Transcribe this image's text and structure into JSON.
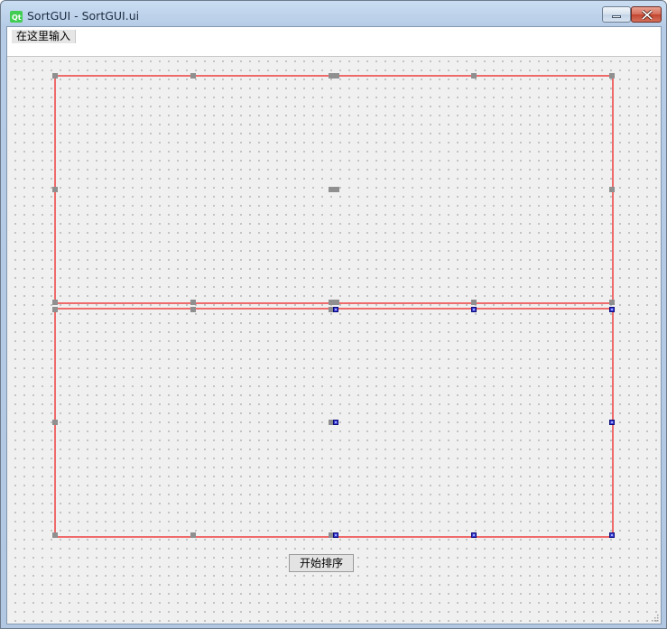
{
  "window": {
    "title": "SortGUI - SortGUI.ui",
    "icons": {
      "app": "qt-designer-icon",
      "minimize": "minimize-icon",
      "close": "close-icon"
    }
  },
  "menubar": {
    "items": [
      {
        "label": "在这里输入"
      }
    ]
  },
  "form": {
    "start_button_label": "开始排序"
  },
  "colors": {
    "layout_border": "#ef6a6a",
    "handle": "#8f8f8f",
    "selected_handle": "#3b3bd0",
    "grid_dot": "#9a9a9a",
    "canvas_bg": "#f0f0f0"
  }
}
